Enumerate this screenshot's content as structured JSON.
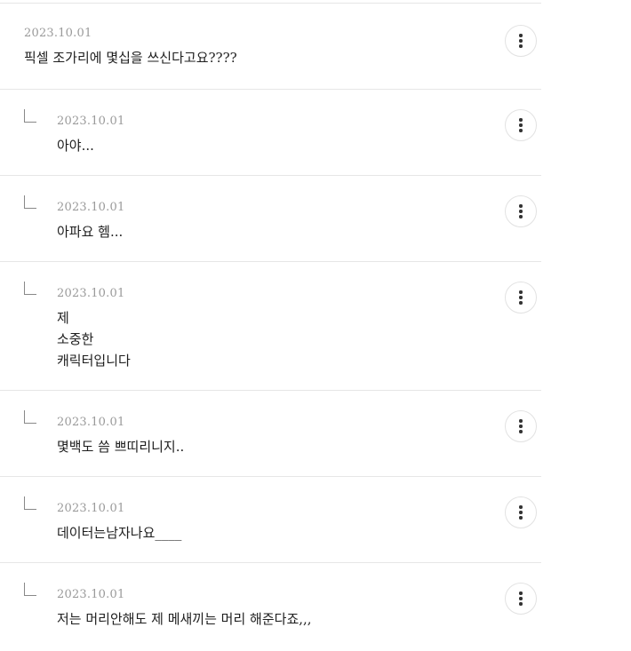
{
  "comments": [
    {
      "kind": "top",
      "date": "2023.10.01",
      "text": "픽셀 조가리에 몇십을 쓰신다고요????",
      "more_icon": "more-vertical-icon"
    },
    {
      "kind": "reply",
      "date": "2023.10.01",
      "text": "아야...",
      "reply_icon": "reply-arrow-icon",
      "more_icon": "more-vertical-icon"
    },
    {
      "kind": "reply",
      "date": "2023.10.01",
      "text": "아파요 헴...",
      "reply_icon": "reply-arrow-icon",
      "more_icon": "more-vertical-icon"
    },
    {
      "kind": "reply",
      "date": "2023.10.01",
      "text": "제\n소중한\n캐릭터입니다",
      "reply_icon": "reply-arrow-icon",
      "more_icon": "more-vertical-icon"
    },
    {
      "kind": "reply",
      "date": "2023.10.01",
      "text": "몇백도 씀 쁘띠리니지..",
      "reply_icon": "reply-arrow-icon",
      "more_icon": "more-vertical-icon"
    },
    {
      "kind": "reply",
      "date": "2023.10.01",
      "text": "데이터는남자나요____",
      "reply_icon": "reply-arrow-icon",
      "more_icon": "more-vertical-icon"
    },
    {
      "kind": "reply",
      "date": "2023.10.01",
      "text": "저는 머리안해도 제 메새끼는 머리 해준다죠,,,",
      "reply_icon": "reply-arrow-icon",
      "more_icon": "more-vertical-icon"
    }
  ],
  "colors": {
    "divider": "#e6e6e6",
    "date_text": "#9a9a9a",
    "body_text": "#1e1e1e",
    "reply_arrow": "#888888"
  }
}
